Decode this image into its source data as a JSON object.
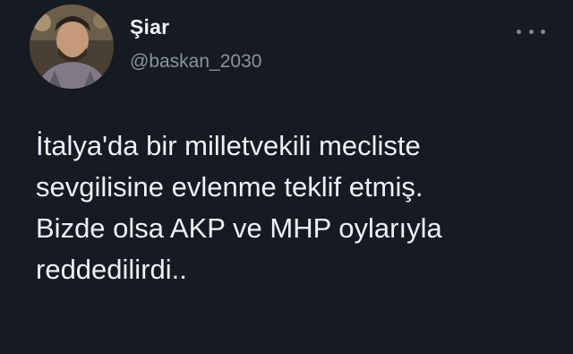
{
  "tweet": {
    "author": {
      "display_name": "Şiar",
      "handle": "@baskan_2030",
      "avatar_icon": "profile-photo"
    },
    "more_icon": "more-options-icon",
    "text_lines": [
      "İtalya'da bir milletvekili mecliste",
      "sevgilisine evlenme teklif etmiş.",
      "Bizde olsa AKP ve MHP oylarıyla",
      "reddedilirdi.."
    ]
  }
}
